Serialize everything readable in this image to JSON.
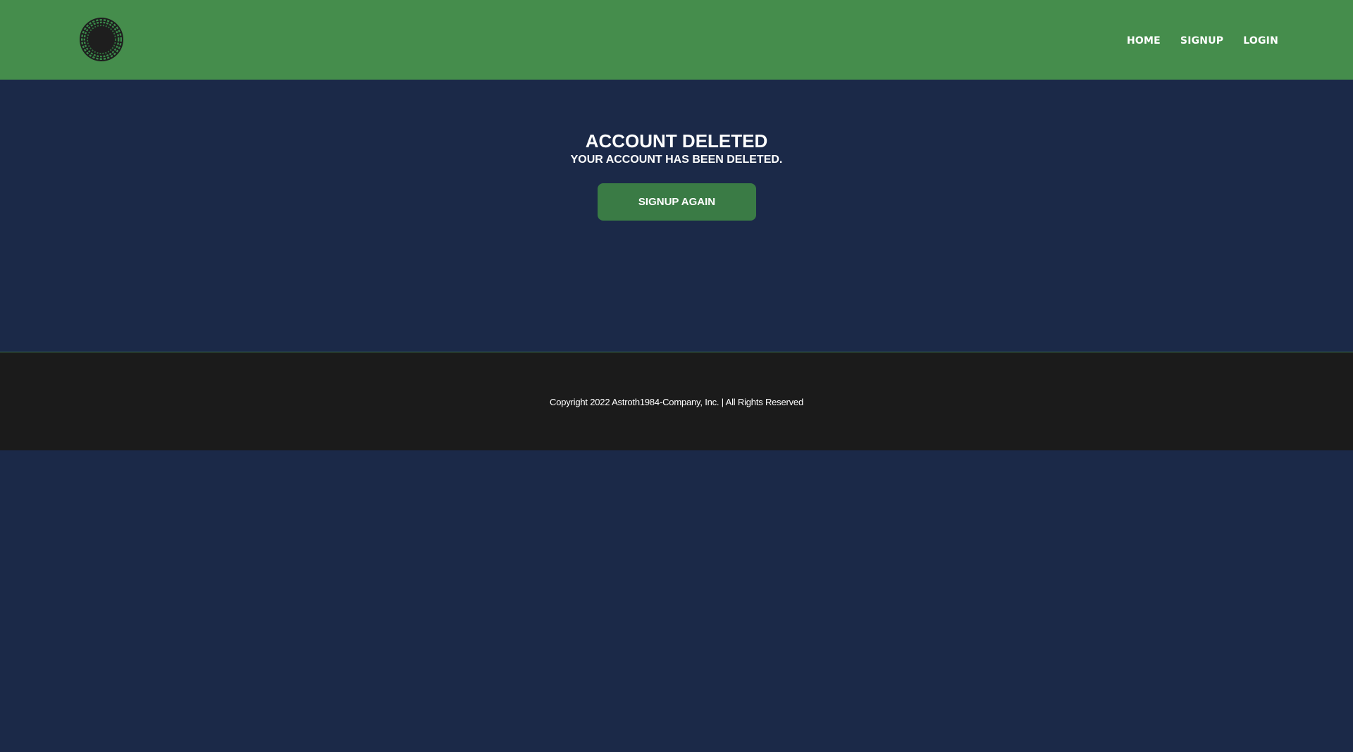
{
  "header": {
    "logo_icon": "circular-emblem-icon",
    "nav": [
      {
        "label": "HOME"
      },
      {
        "label": "SIGNUP"
      },
      {
        "label": "LOGIN"
      }
    ]
  },
  "main": {
    "title": "ACCOUNT DELETED",
    "subtitle": "YOUR ACCOUNT HAS BEEN DELETED.",
    "button_label": "SIGNUP AGAIN"
  },
  "footer": {
    "copyright": "Copyright 2022 Astroth1984-Company, Inc. | All Rights Reserved"
  },
  "colors": {
    "header_bg": "#458d4c",
    "page_bg": "#1b2948",
    "button_bg": "#3a7b45",
    "footer_bg": "#1b1b1b"
  }
}
